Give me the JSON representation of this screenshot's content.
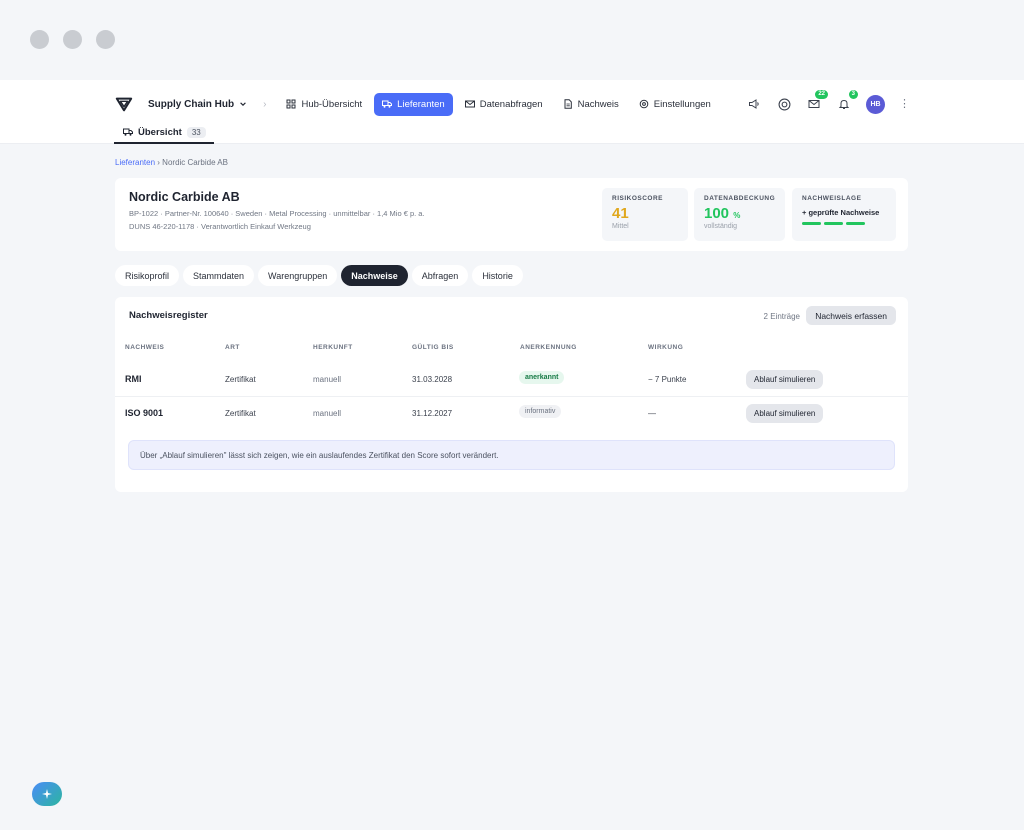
{
  "nav": {
    "app_name": "Supply Chain Hub",
    "items": [
      {
        "label": "Hub-Übersicht",
        "icon": "grid-icon",
        "active": false
      },
      {
        "label": "Lieferanten",
        "icon": "truck-icon",
        "active": true
      },
      {
        "label": "Datenabfragen",
        "icon": "mail-icon",
        "active": false
      },
      {
        "label": "Nachweis",
        "icon": "document-icon",
        "active": false
      },
      {
        "label": "Einstellungen",
        "icon": "gear-icon",
        "active": false
      }
    ],
    "mail_count": "22",
    "notification_count": "3",
    "avatar_initials": "HB"
  },
  "subtab": {
    "label": "Übersicht",
    "count": "33"
  },
  "breadcrumb": {
    "parent": "Lieferanten",
    "separator": "›",
    "current": "Nordic Carbide AB"
  },
  "supplier": {
    "name": "Nordic Carbide AB",
    "meta_line1": "BP-1022 · Partner-Nr. 100640 · Sweden · Metal Processing · unmittelbar · 1,4 Mio € p. a.",
    "meta_line2": "DUNS 46-220-1178 · Verantwortlich Einkauf Werkzeug"
  },
  "kpis": {
    "risk": {
      "label": "RISIKOSCORE",
      "value": "41",
      "sub": "Mittel",
      "color": "#e0a81e"
    },
    "coverage": {
      "label": "DATENABDECKUNG",
      "value": "100",
      "unit": "%",
      "sub": "vollständig",
      "color": "#22c55e"
    },
    "proof": {
      "label": "NACHWEISLAGE",
      "text": "+ geprüfte Nachweise",
      "bar_fill_fraction": 0.85
    }
  },
  "tabs": [
    "Risikoprofil",
    "Stammdaten",
    "Warengruppen",
    "Nachweise",
    "Abfragen",
    "Historie"
  ],
  "active_tab": "Nachweise",
  "register": {
    "title": "Nachweisregister",
    "count_label": "2 Einträge",
    "add_label": "Nachweis erfassen",
    "columns": [
      "NACHWEIS",
      "ART",
      "HERKUNFT",
      "GÜLTIG BIS",
      "ANERKENNUNG",
      "WIRKUNG"
    ],
    "rows": [
      {
        "name": "RMI",
        "art": "Zertifikat",
        "herkunft": "manuell",
        "gueltig": "31.03.2028",
        "anerkennung": "anerkannt",
        "wirkung": "− 7 Punkte",
        "action": "Ablauf simulieren"
      },
      {
        "name": "ISO 9001",
        "art": "Zertifikat",
        "herkunft": "manuell",
        "gueltig": "31.12.2027",
        "anerkennung": "informativ",
        "wirkung": "—",
        "action": "Ablauf simulieren"
      }
    ],
    "info": "Über „Ablauf simulieren\" lässt sich zeigen, wie ein auslaufendes Zertifikat den Score sofort verändert."
  },
  "colors": {
    "accent": "#4a6cf7",
    "success": "#22c55e",
    "warning": "#e0a81e"
  }
}
